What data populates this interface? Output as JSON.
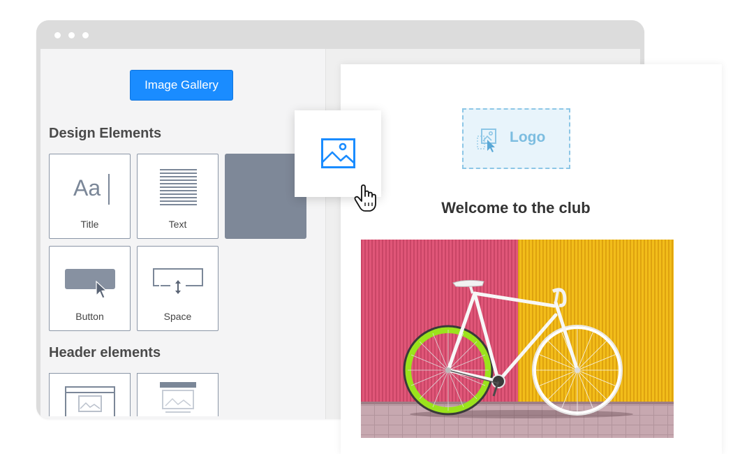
{
  "sidebar": {
    "gallery_button": "Image Gallery",
    "design_section": {
      "title": "Design Elements",
      "tiles": [
        {
          "label": "Title",
          "icon_text": "Aa",
          "icon": "title-icon"
        },
        {
          "label": "Text",
          "icon": "text-lines-icon"
        },
        {
          "label": "",
          "icon": "image-placeholder"
        },
        {
          "label": "Button",
          "icon": "button-icon"
        },
        {
          "label": "Space",
          "icon": "space-icon"
        }
      ]
    },
    "header_section": {
      "title": "Header elements",
      "tiles": [
        {
          "icon": "header-layout-icon"
        },
        {
          "icon": "header-banner-icon"
        }
      ]
    }
  },
  "drag": {
    "icon": "image-icon",
    "cursor": "hand-pointer-icon"
  },
  "canvas": {
    "logo_placeholder": "Logo",
    "heading": "Welcome to the club",
    "hero_image": "bicycle-photo"
  },
  "colors": {
    "accent": "#1a8cff",
    "tile_gray": "#7e8898",
    "logo_blue": "#7cbde0",
    "wall_pink": "#e05678",
    "wall_yellow": "#f2bd1a",
    "rim_green": "#9be31c"
  }
}
